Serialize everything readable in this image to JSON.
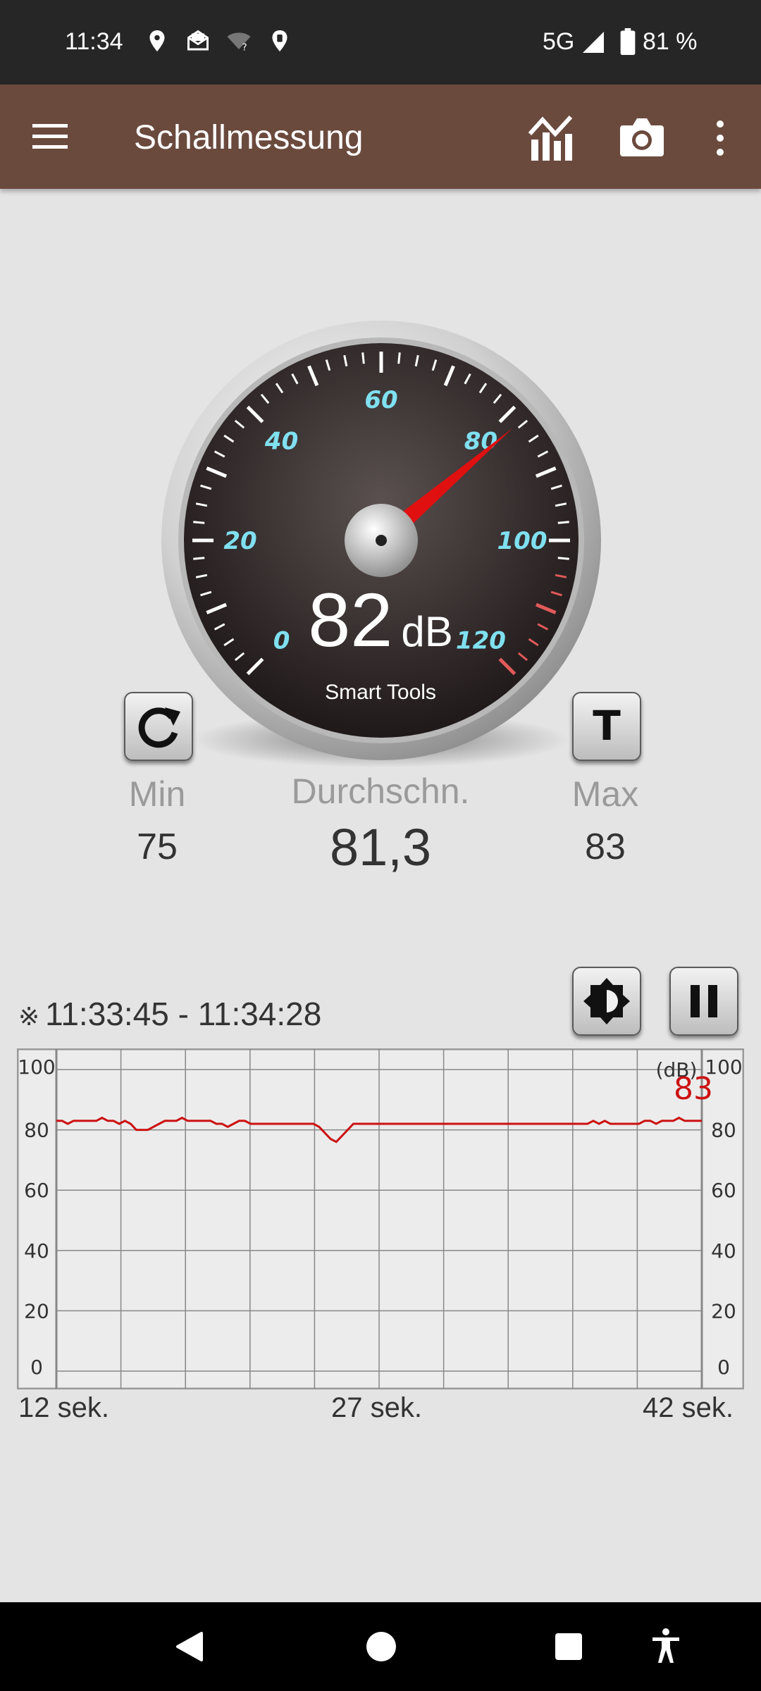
{
  "status_bar": {
    "time": "11:34",
    "network": "5G",
    "battery": "81 %",
    "icons": [
      "location-icon",
      "mail-icon",
      "wifi-unknown-icon",
      "maps-icon",
      "signal-icon",
      "battery-icon"
    ]
  },
  "app_bar": {
    "title": "Schallmessung",
    "icons": [
      "menu-icon",
      "chart-icon",
      "camera-icon",
      "more-icon"
    ],
    "color": "#6b4a3e"
  },
  "gauge": {
    "value": "82",
    "unit": "dB",
    "brand": "Smart Tools",
    "scale_labels": [
      "0",
      "20",
      "40",
      "60",
      "80",
      "100",
      "120"
    ],
    "needle_value": 82,
    "label_color": "#7fe0f0",
    "needle_color": "#e01010"
  },
  "stats": {
    "min_label": "Min",
    "min_value": "75",
    "avg_label": "Durchschn.",
    "avg_value": "81,3",
    "max_label": "Max",
    "max_value": "83"
  },
  "buttons": {
    "reset": "refresh-icon",
    "t_label": "T",
    "brightness": "brightness-icon",
    "pause": "pause-icon"
  },
  "history": {
    "mark": "※",
    "time_range": "11:33:45 - 11:34:28",
    "x_labels": [
      "12 sek.",
      "27 sek.",
      "42 sek."
    ]
  },
  "chart_data": {
    "type": "line",
    "unit_label": "(dB)",
    "current_value": "83",
    "y_ticks": [
      "100",
      "80",
      "60",
      "40",
      "20",
      "0"
    ],
    "ylim": [
      0,
      100
    ],
    "grid": true,
    "line_color": "#cc1111",
    "values": [
      83,
      83,
      82,
      83,
      83,
      83,
      83,
      83,
      84,
      83,
      83,
      82,
      83,
      82,
      80,
      80,
      80,
      81,
      82,
      83,
      83,
      83,
      84,
      83,
      83,
      83,
      83,
      83,
      82,
      82,
      81,
      82,
      83,
      83,
      82,
      82,
      82,
      82,
      82,
      82,
      82,
      82,
      82,
      82,
      82,
      82,
      81,
      79,
      77,
      76,
      78,
      80,
      82,
      82,
      82,
      82,
      82,
      82,
      82,
      82,
      82,
      82,
      82,
      82,
      82,
      82,
      82,
      82,
      82,
      82,
      82,
      82,
      82,
      82,
      82,
      82,
      82,
      82,
      82,
      82,
      82,
      82,
      82,
      82,
      82,
      82,
      82,
      82,
      82,
      82,
      82,
      82,
      82,
      82,
      83,
      82,
      83,
      82,
      82,
      82,
      82,
      82,
      82,
      83,
      83,
      82,
      83,
      83,
      83,
      84,
      83,
      83,
      83,
      83
    ]
  },
  "nav_bar": {
    "icons": [
      "back-icon",
      "home-icon",
      "recents-icon",
      "accessibility-icon"
    ]
  }
}
